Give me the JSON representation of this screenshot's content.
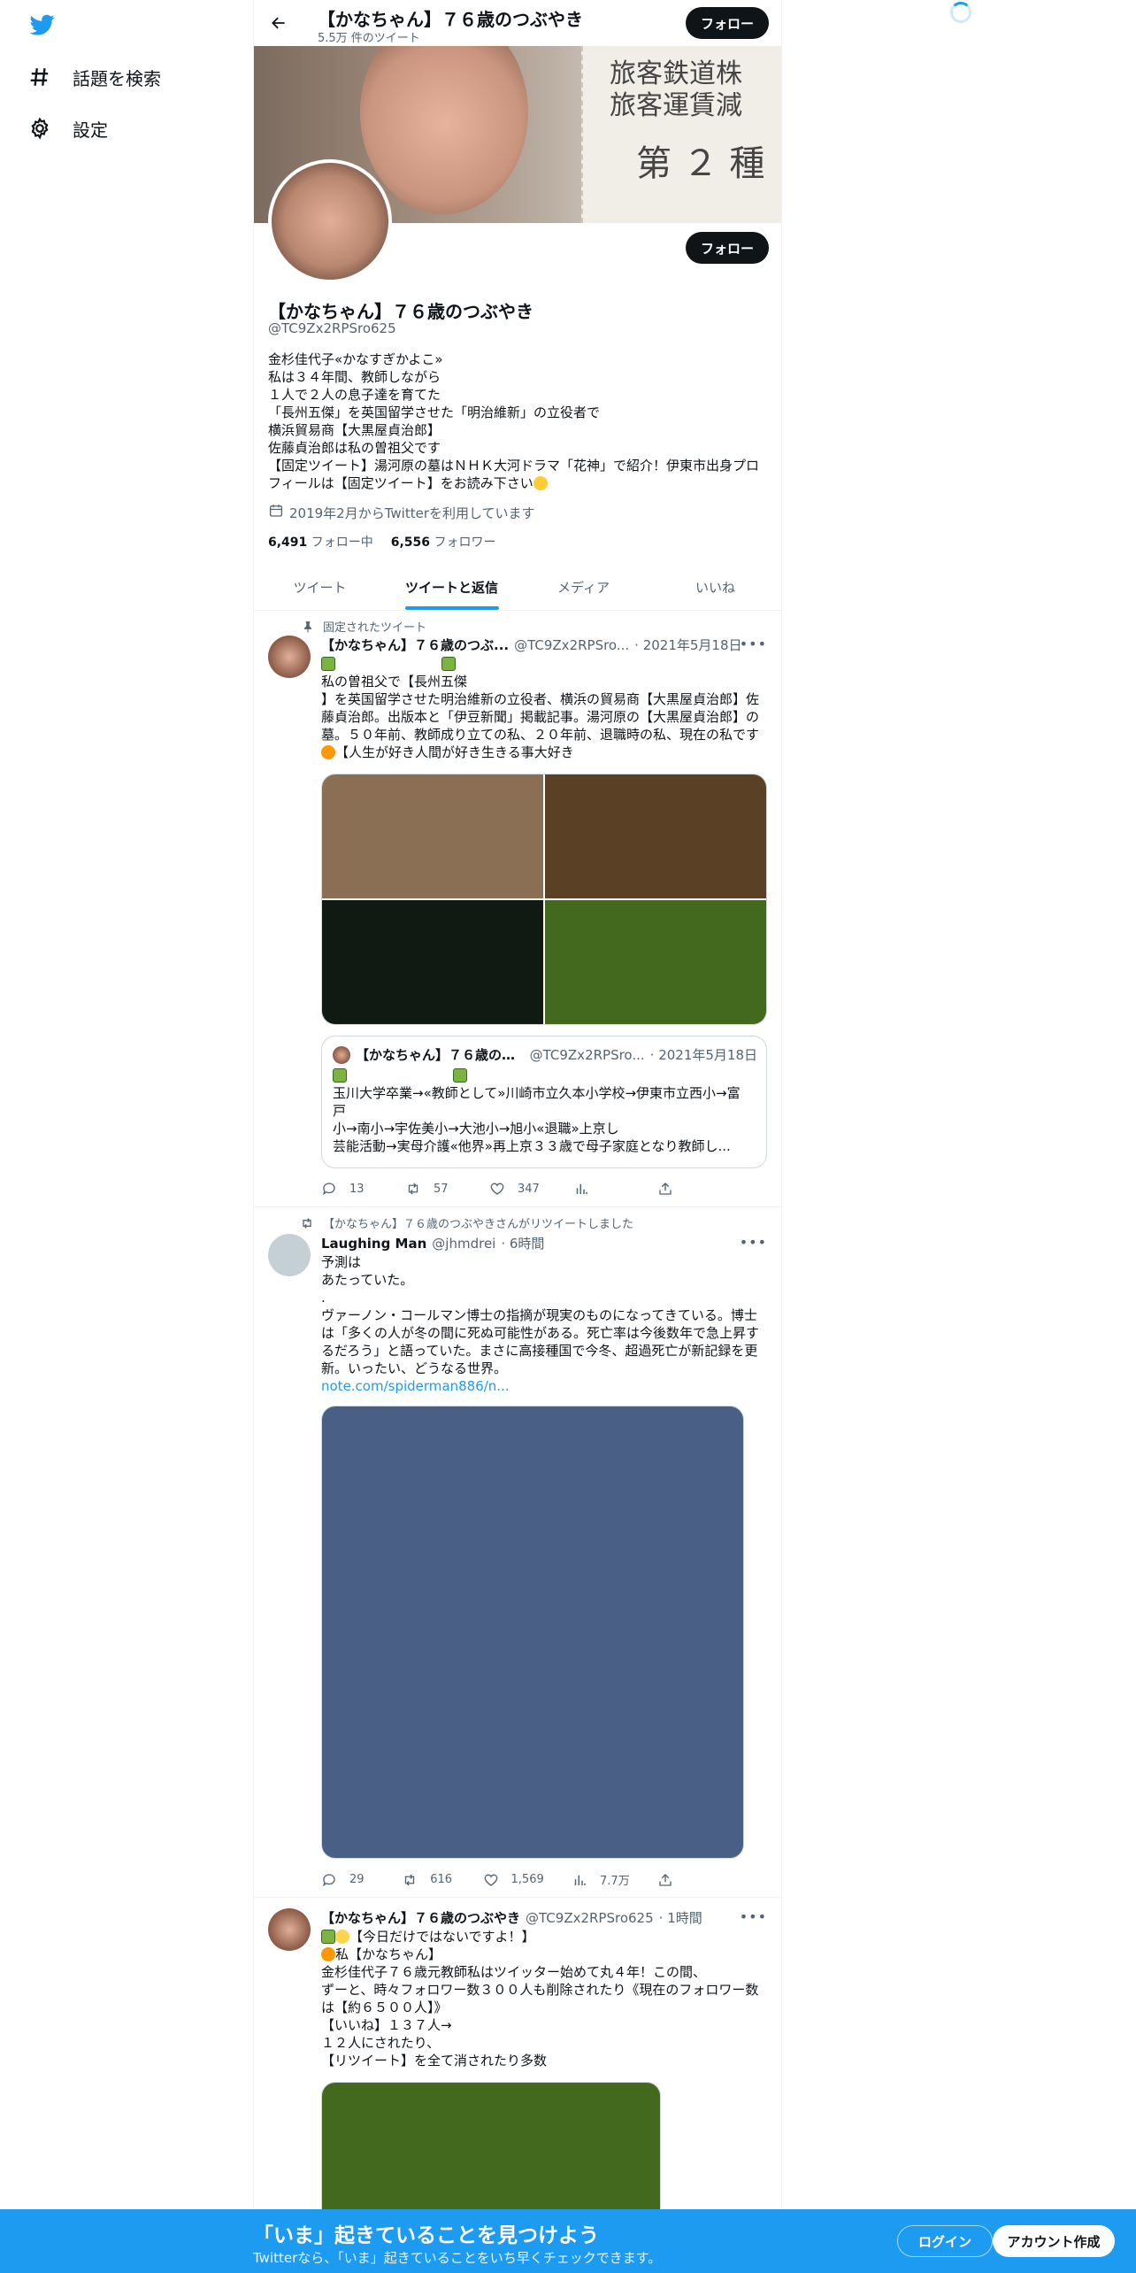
{
  "nav": {
    "explore_label": "話題を検索",
    "settings_label": "設定"
  },
  "header": {
    "name": "【かなちゃん】７６歳のつぶやき",
    "tweet_count": "5.5万 件のツイート",
    "follow_label": "フォロー"
  },
  "profile": {
    "name": "【かなちゃん】７６歳のつぶやき",
    "handle": "@TC9Zx2RPSro625",
    "follow_label": "フォロー",
    "bio": [
      "金杉佳代子«かなすぎかよこ»",
      "私は３４年間、教師しながら",
      "１人で２人の息子達を育てた",
      "「長州五傑」を英国留学させた「明治維新」の立役者で",
      "横浜貿易商【大黒屋貞治郎】",
      "佐藤貞治郎は私の曽祖父です",
      "【固定ツイート】湯河原の墓はＮＨＫ大河ドラマ「花神」で紹介！伊東市出身プロ",
      "フィールは【固定ツイート】をお読み下さい"
    ],
    "joined": "2019年2月からTwitterを利用しています",
    "following_count": "6,491",
    "following_label": "フォロー中",
    "followers_count": "6,556",
    "followers_label": "フォロワー"
  },
  "tabs": [
    "ツイート",
    "ツイートと返信",
    "メディア",
    "いいね"
  ],
  "tweets": [
    {
      "context": "固定されたツイート",
      "name": "【かなちゃん】７６歳のつぶ...",
      "handle": "@TC9Zx2RPSro...",
      "time": "· 2021年5月18日",
      "lines": [
        "私の曽祖父で【長州五傑",
        "】を英国留学させた明治維新の立役者、横浜の貿易商【大黒屋貞治郎】佐",
        "藤貞治郎。出版本と「伊豆新聞」掲載記事。湯河原の【大黒屋貞治郎】の",
        "墓。５０年前、教師成り立ての私、２０年前、退職時の私、現在の私です",
        "【人生が好き人間が好き生きる事大好き"
      ],
      "quote": {
        "name": "【かなちゃん】７６歳のつぶ...",
        "handle": "@TC9Zx2RPSro...",
        "time": "· 2021年5月18日",
        "lines": [
          "玉川大学卒業→«教師として»川崎市立久本小学校→伊東市立西小→富",
          "戸",
          "小→南小→宇佐美小→大池小→旭小«退職»上京し",
          "芸能活動→実母介護«他界»再上京３３歳で母子家庭となり教師し..."
        ]
      },
      "replies": "13",
      "retweets": "57",
      "likes": "347"
    },
    {
      "context": "【かなちゃん】７６歳のつぶやきさんがリツイートしました",
      "name": "Laughing Man",
      "handle": "@jhmdrei",
      "time": "· 6時間",
      "lines": [
        "予測は",
        "あたっていた。",
        "",
        "ヴァーノン・コールマン博士の指摘が現実のものになってきている。博士",
        "は「多くの人が冬の間に死ぬ可能性がある。死亡率は今後数年で急上昇す",
        "るだろう」と語っていた。まさに高接種国で今冬、超過死亡が新記録を更",
        "新。いったい、どうなる世界。"
      ],
      "link": "note.com/spiderman886/n...",
      "replies": "29",
      "retweets": "616",
      "likes": "1,569",
      "views": "7.7万"
    },
    {
      "name": "【かなちゃん】７６歳のつぶやき",
      "handle": "@TC9Zx2RPSro625",
      "time": "· 1時間",
      "lines": [
        "【今日だけではないですよ！】",
        "私【かなちゃん】",
        "金杉佳代子７６歳元教師私はツイッター始めて丸４年！この間、",
        "ずーと、時々フォロワー数３００人も削除されたり《現在のフォロワー数",
        "は【約６５００人】》",
        "【いいね】１３７人→",
        "１２人にされたり、",
        "【リツイート】を全て消されたり多数"
      ]
    }
  ],
  "bottom": {
    "title": "「いま」起きていることを見つけよう",
    "subtitle": "Twitterなら、「いま」起きていることをいち早くチェックできます。",
    "login_label": "ログイン",
    "signup_label": "アカウント作成"
  },
  "colors": {
    "accent": "#1d9bf0",
    "text": "#0f1419",
    "muted": "#536471"
  }
}
